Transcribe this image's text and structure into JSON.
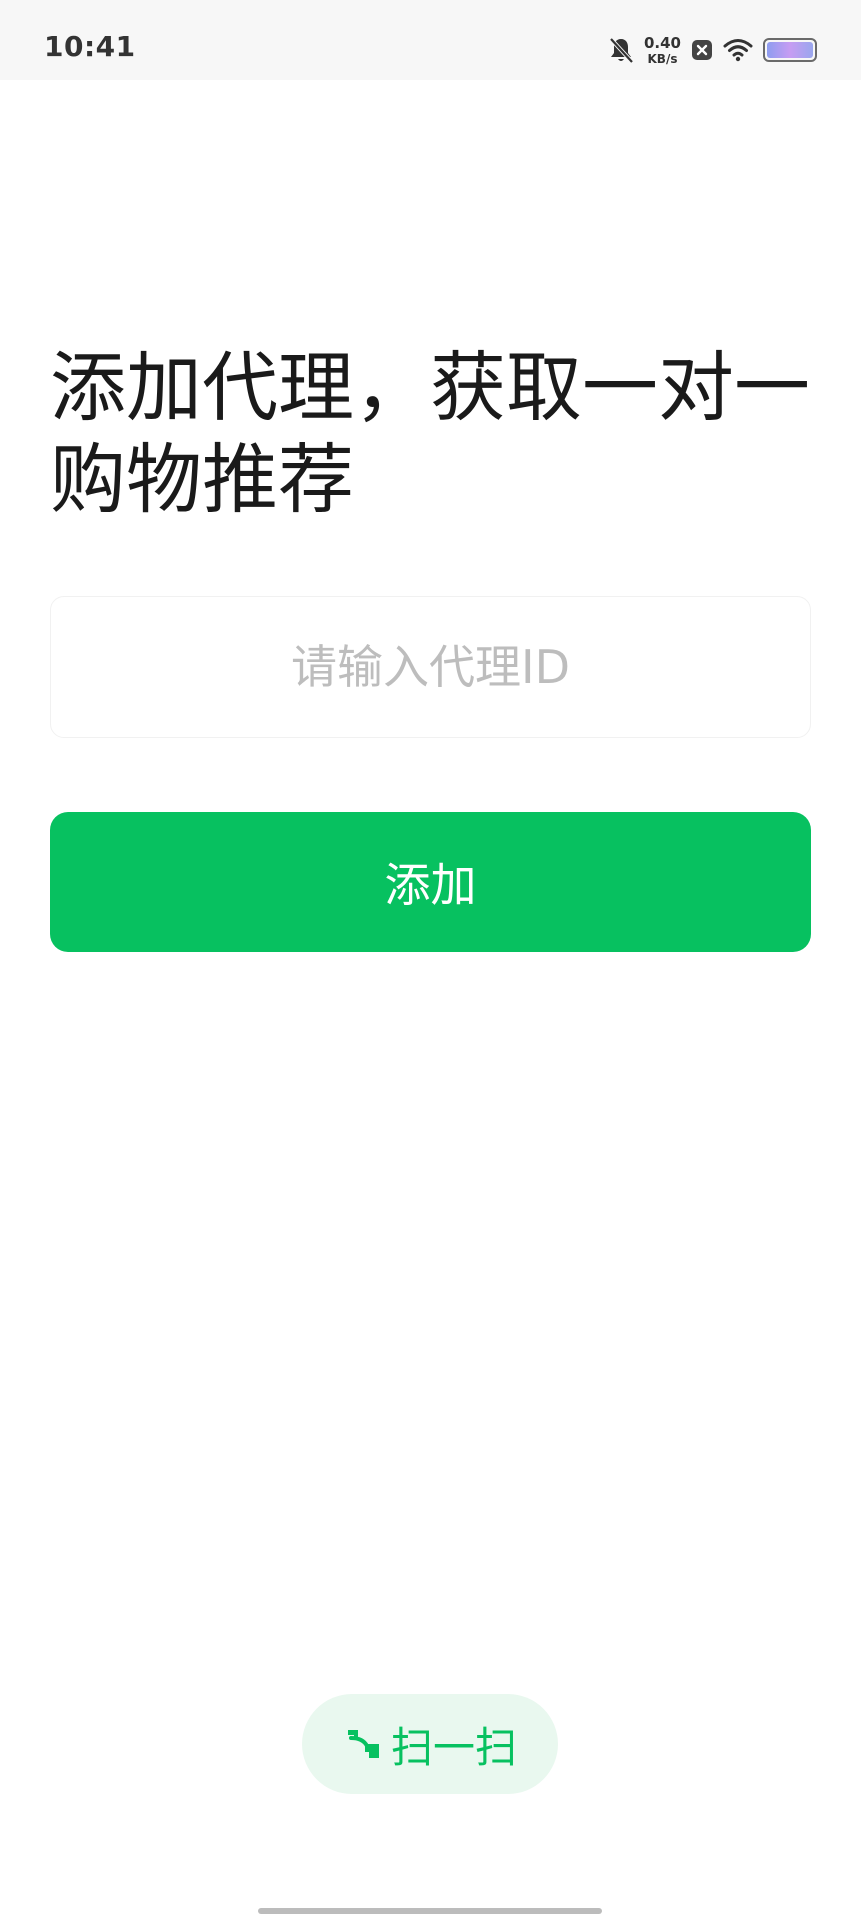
{
  "status_bar": {
    "time": "10:41",
    "net_speed_value": "0.40",
    "net_speed_unit": "KB/s",
    "icons": [
      "bell-muted-icon",
      "close-box-icon",
      "wifi-icon",
      "battery-icon"
    ]
  },
  "title": "添加代理，获取一对一购物推荐",
  "agent_input": {
    "value": "",
    "placeholder": "请输入代理ID"
  },
  "add_button": {
    "label": "添加"
  },
  "scan_button": {
    "label": "扫一扫",
    "icon": "scan-icon"
  },
  "colors": {
    "primary": "#07c160",
    "scan_bg": "#e9f8ef",
    "title_text": "#1a1a1a",
    "placeholder": "#bdbdbd"
  }
}
